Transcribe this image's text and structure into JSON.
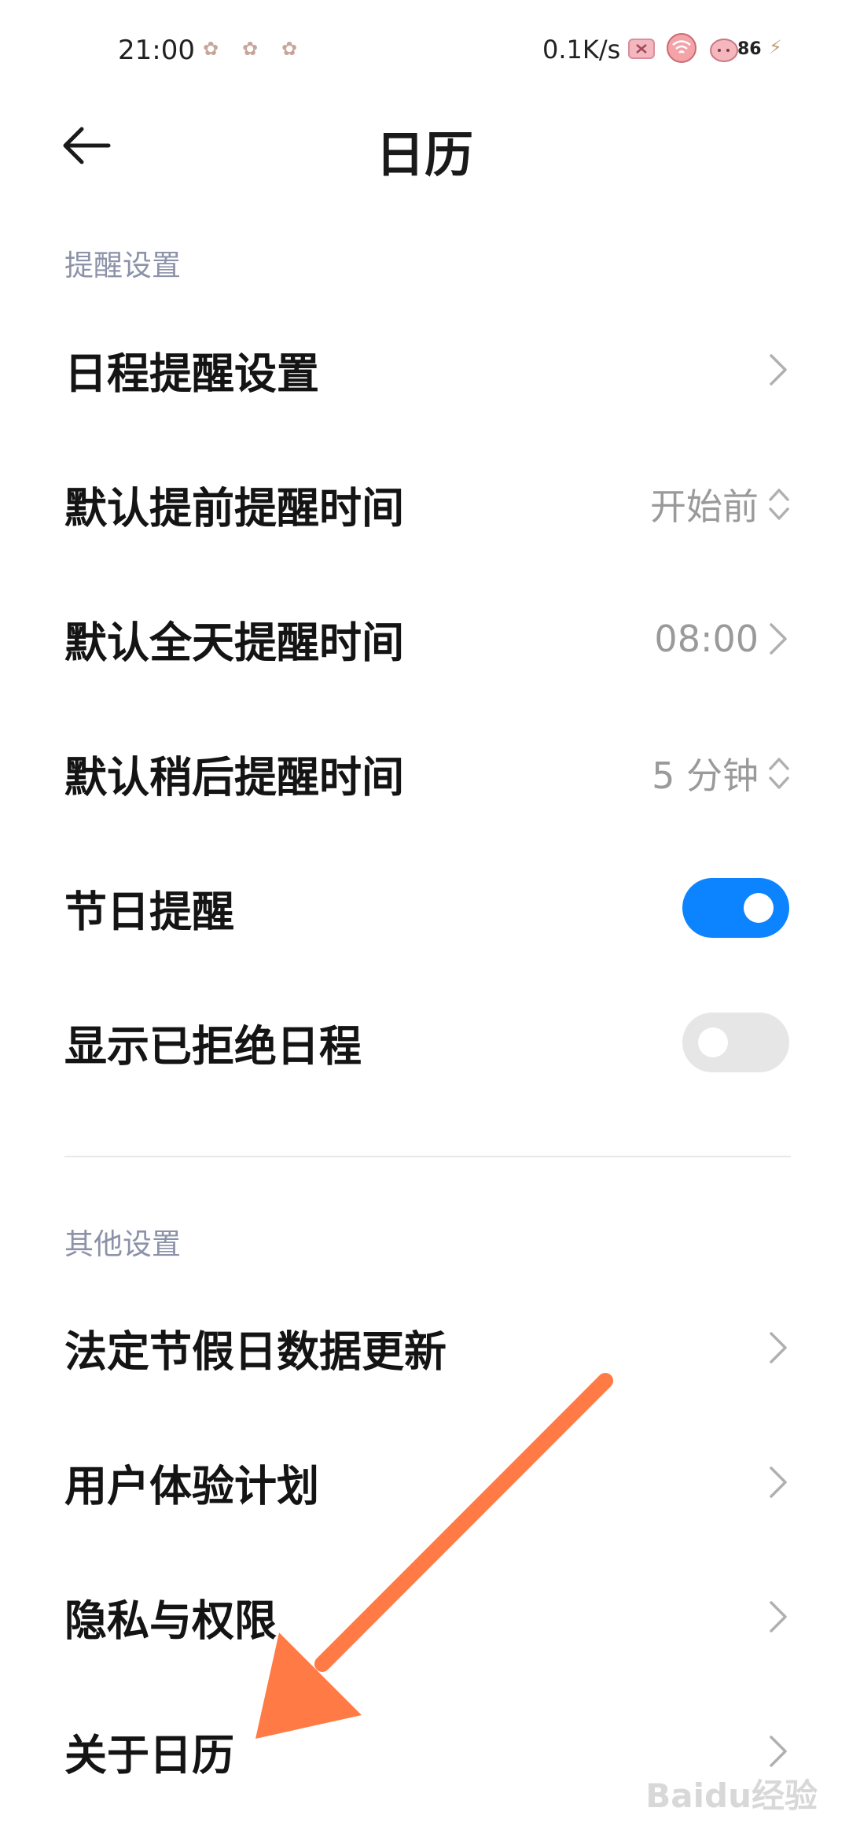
{
  "status_bar": {
    "time": "21:00",
    "net_speed": "0.1K/s",
    "battery": "86"
  },
  "header": {
    "title": "日历"
  },
  "sections": {
    "reminder": {
      "label": "提醒设置",
      "items": [
        {
          "label": "日程提醒设置"
        },
        {
          "label": "默认提前提醒时间",
          "value": "开始前"
        },
        {
          "label": "默认全天提醒时间",
          "value": "08:00"
        },
        {
          "label": "默认稍后提醒时间",
          "value": "5 分钟"
        },
        {
          "label": "节日提醒",
          "toggle": true
        },
        {
          "label": "显示已拒绝日程",
          "toggle": false
        }
      ]
    },
    "other": {
      "label": "其他设置",
      "items": [
        {
          "label": "法定节假日数据更新"
        },
        {
          "label": "用户体验计划"
        },
        {
          "label": "隐私与权限"
        },
        {
          "label": "关于日历"
        }
      ]
    }
  },
  "colors": {
    "accent": "#0d84ff",
    "annotation_arrow": "#ff7a45",
    "section_label": "#8c93a8"
  },
  "watermark": "Baidu经验"
}
